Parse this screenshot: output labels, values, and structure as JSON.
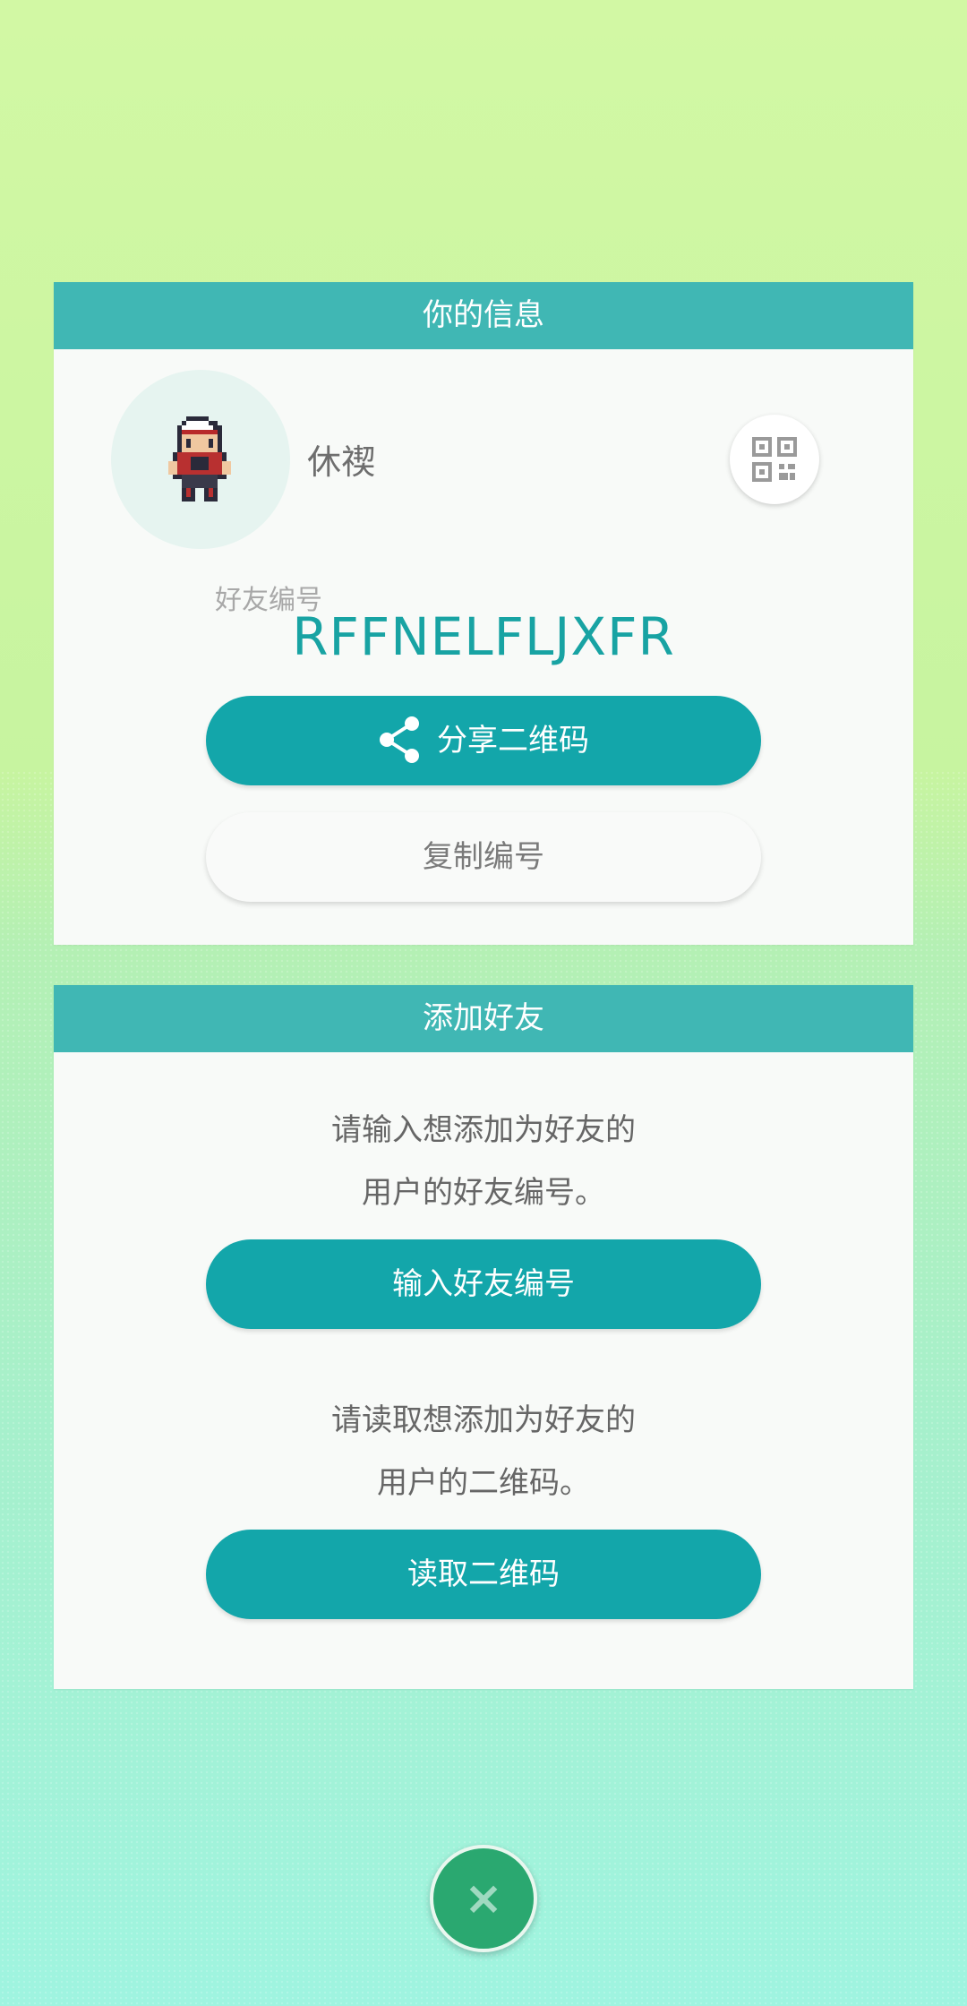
{
  "info_card": {
    "title": "你的信息",
    "username": "休禊",
    "friend_code_label": "好友编号",
    "friend_code": "RFFNELFLJXFR",
    "share_button_label": "分享二维码",
    "copy_button_label": "复制编号"
  },
  "add_card": {
    "title": "添加好友",
    "instruction_code_line1": "请输入想添加为好友的",
    "instruction_code_line2": "用户的好友编号。",
    "enter_code_button_label": "输入好友编号",
    "instruction_qr_line1": "请读取想添加为好友的",
    "instruction_qr_line2": "用户的二维码。",
    "scan_qr_button_label": "读取二维码"
  },
  "close_button_glyph": "×",
  "colors": {
    "header_teal": "#40b7b4",
    "button_teal": "#13a6aa",
    "friend_code_teal": "#18a3a3",
    "close_green": "#2aa870"
  },
  "icons": [
    "avatar-sprite",
    "qr-code-icon",
    "share-icon",
    "close-icon"
  ]
}
